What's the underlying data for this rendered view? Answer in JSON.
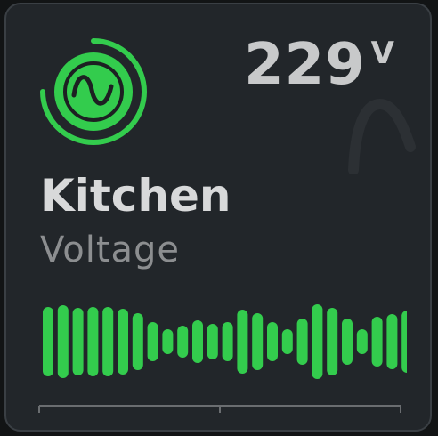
{
  "entity": {
    "name": "Kitchen",
    "subtitle": "Voltage",
    "value": "229",
    "unit": "V",
    "icon": "sine-wave-icon"
  },
  "colors": {
    "accent": "#33cc4d",
    "card_bg": "#22262a",
    "value_text": "#c8c9ca",
    "name_text": "#d8d9da",
    "sub_text": "#8c8e90",
    "axis": "#6a6d70"
  },
  "chart_data": {
    "type": "bar",
    "bar_half_heights": [
      33,
      35,
      32,
      33,
      33,
      31,
      26,
      16,
      8,
      12,
      18,
      14,
      16,
      30,
      26,
      16,
      8,
      20,
      36,
      32,
      20,
      8,
      22,
      25,
      29,
      22,
      0,
      20,
      32
    ],
    "empty_slots": [
      26
    ],
    "connector_slot": 26
  }
}
